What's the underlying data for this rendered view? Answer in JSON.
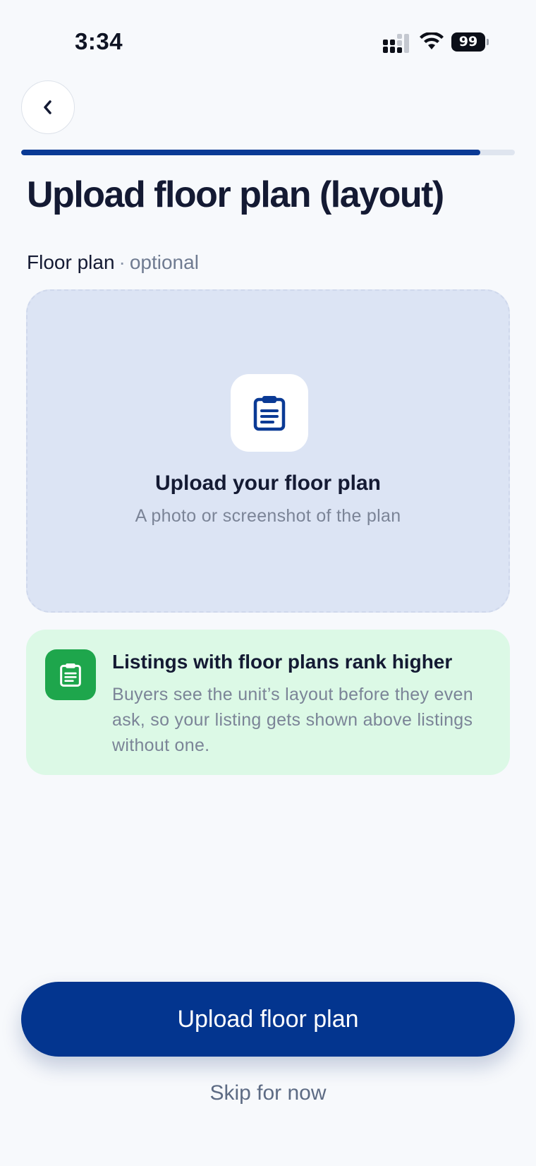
{
  "status_bar": {
    "time": "3:34",
    "battery_level": "99"
  },
  "header": {
    "back_icon": "chevron-left-icon",
    "progress": 0.93
  },
  "page": {
    "title": "Upload floor plan (layout)"
  },
  "field": {
    "label": "Floor plan",
    "separator": "·",
    "optional": "optional"
  },
  "dropzone": {
    "icon": "clipboard-icon",
    "title": "Upload your floor plan",
    "subtitle": "A photo or screenshot of the plan"
  },
  "tip": {
    "icon": "clipboard-icon",
    "title": "Listings with floor plans rank higher",
    "body": "Buyers see the unit’s layout before they even ask, so your listing gets shown above listings without one."
  },
  "actions": {
    "primary_label": "Upload floor plan",
    "skip_label": "Skip for now"
  },
  "colors": {
    "accent": "#03358f",
    "progress_fill": "#0a3a95",
    "dropzone_bg": "#dce4f4",
    "tip_bg": "#dcf9e6",
    "tip_icon_bg": "#1ea64c"
  }
}
